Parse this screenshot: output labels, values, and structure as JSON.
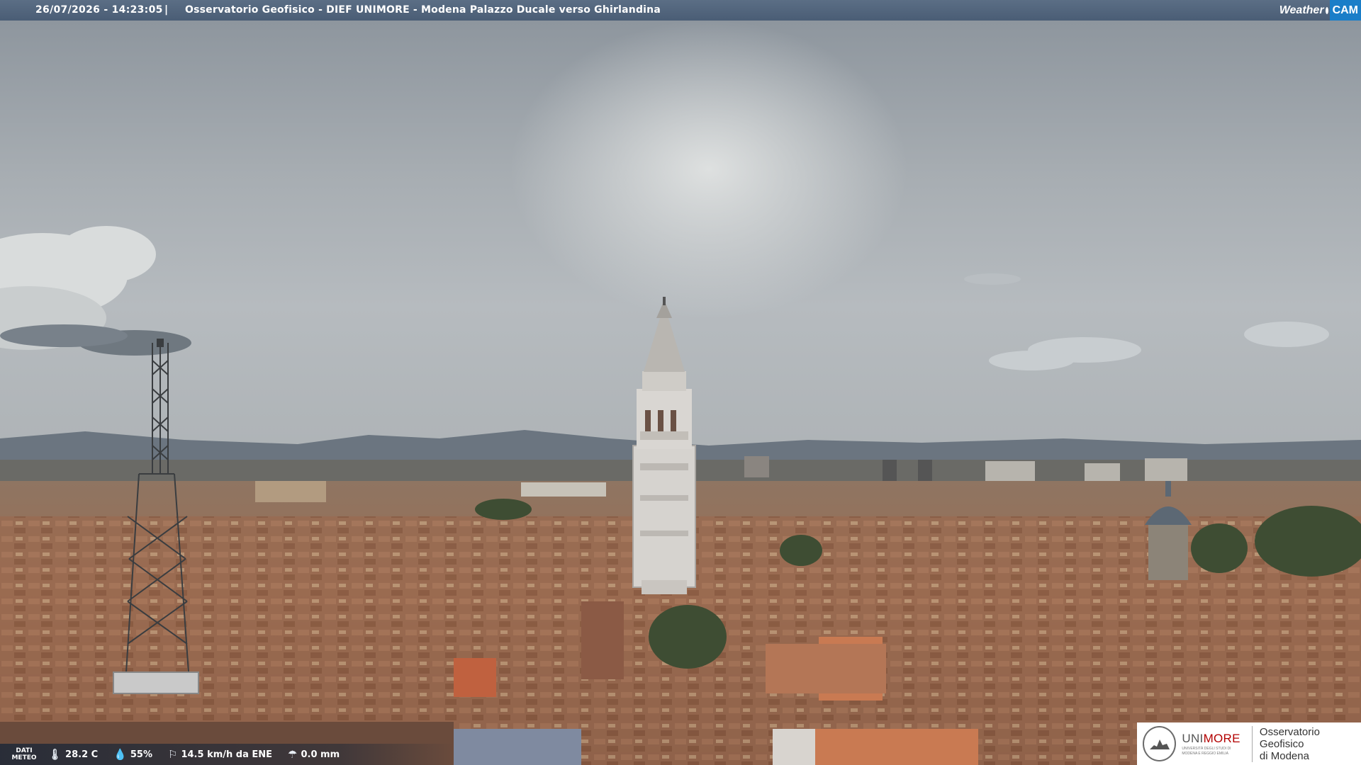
{
  "header": {
    "datetime": "26/07/2026 - 14:23:05",
    "separator": "|",
    "title": "Osservatorio Geofisico - DIEF UNIMORE - Modena Palazzo Ducale verso Ghirlandina",
    "logo_weather": "Weather",
    "logo_cam": "CAM"
  },
  "meteo": {
    "label_line1": "DATI",
    "label_line2": "METEO",
    "temperature": "28.2 C",
    "humidity": "55%",
    "wind": "14.5 km/h da ENE",
    "rain": "0.0 mm",
    "icons": [
      "thermometer-icon",
      "humidity-icon",
      "wind-icon",
      "rain-icon"
    ]
  },
  "branding": {
    "university_prefix": "UNI",
    "university_suffix": "MORE",
    "university_sub1": "UNIVERSITÀ DEGLI STUDI DI",
    "university_sub2": "MODENA E REGGIO EMILIA",
    "observatory_line1": "Osservatorio Geofisico",
    "observatory_line2": "di Modena"
  },
  "colors": {
    "header_bg": "#4f6279",
    "unimore_red": "#b30000",
    "weathercam_blue": "#1a7ec8"
  }
}
